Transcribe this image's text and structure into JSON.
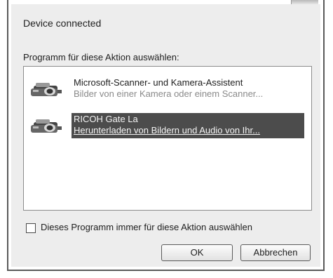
{
  "dialog": {
    "device_title": "Device connected",
    "program_label": "Programm für diese Aktion auswählen:",
    "programs": [
      {
        "title": "Microsoft-Scanner- und Kamera-Assistent",
        "description": "Bilder von einer Kamera oder einem Scanner...",
        "icon": "camera-icon",
        "selected": false
      },
      {
        "title": "RICOH Gate La",
        "description": "Herunterladen von Bildern und Audio von Ihr...",
        "icon": "camera-icon",
        "selected": true
      }
    ],
    "always_checkbox": {
      "label": "Dieses Programm immer für diese Aktion auswählen",
      "checked": false
    },
    "ok_label": "OK",
    "cancel_label": "Abbrechen"
  }
}
